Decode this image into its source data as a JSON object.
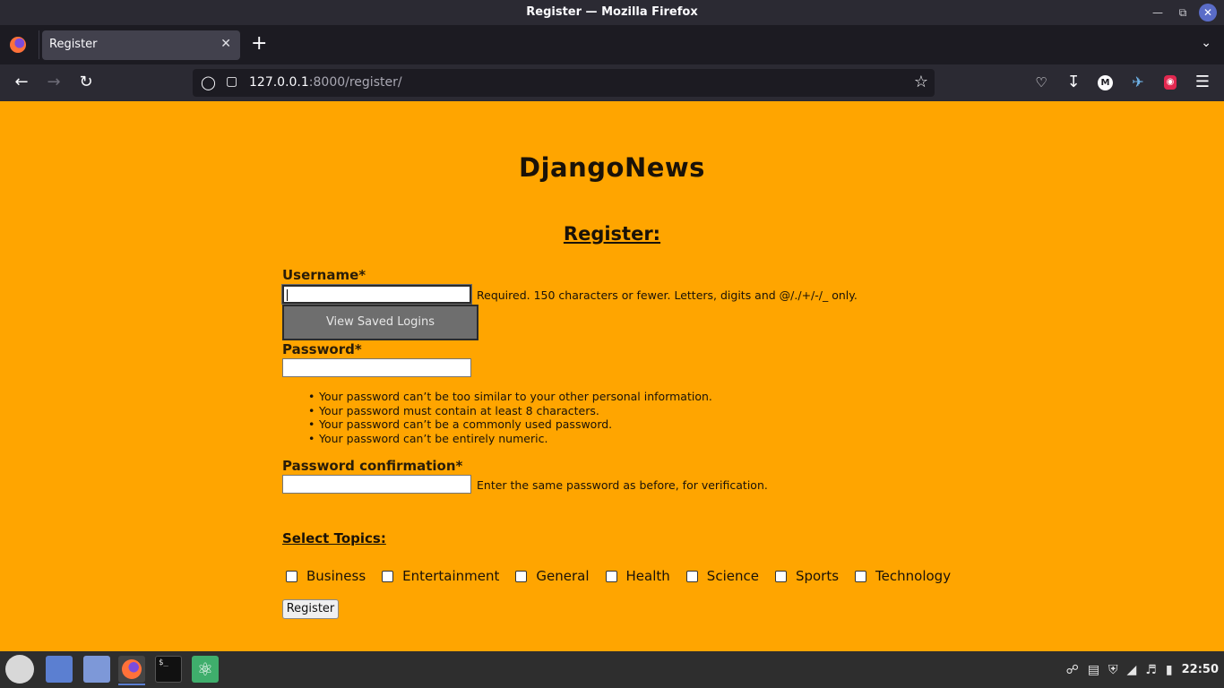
{
  "window": {
    "title": "Register — Mozilla Firefox"
  },
  "browser": {
    "tab_title": "Register",
    "url_host": "127.0.0.1",
    "url_rest": ":8000/register/"
  },
  "page": {
    "site_title": "DjangoNews",
    "form_heading": "Register:",
    "username": {
      "label": "Username*",
      "value": "",
      "help": "Required. 150 characters or fewer. Letters, digits and @/./+/-/_ only."
    },
    "autocomplete_label": "View Saved Logins",
    "password": {
      "label": "Password*",
      "value": "",
      "rules": [
        "Your password can’t be too similar to your other personal information.",
        "Your password must contain at least 8 characters.",
        "Your password can’t be a commonly used password.",
        "Your password can’t be entirely numeric."
      ]
    },
    "password_confirmation": {
      "label": "Password confirmation*",
      "value": "",
      "help": "Enter the same password as before, for verification."
    },
    "topics_heading": "Select Topics:",
    "topics": [
      "Business",
      "Entertainment",
      "General",
      "Health",
      "Science",
      "Sports",
      "Technology"
    ],
    "register_button": "Register"
  },
  "taskbar": {
    "clock": "22:50"
  },
  "colors": {
    "page_background": "#ffa500",
    "browser_chrome": "#2b2a33",
    "taskbar": "#2e2e2e"
  }
}
